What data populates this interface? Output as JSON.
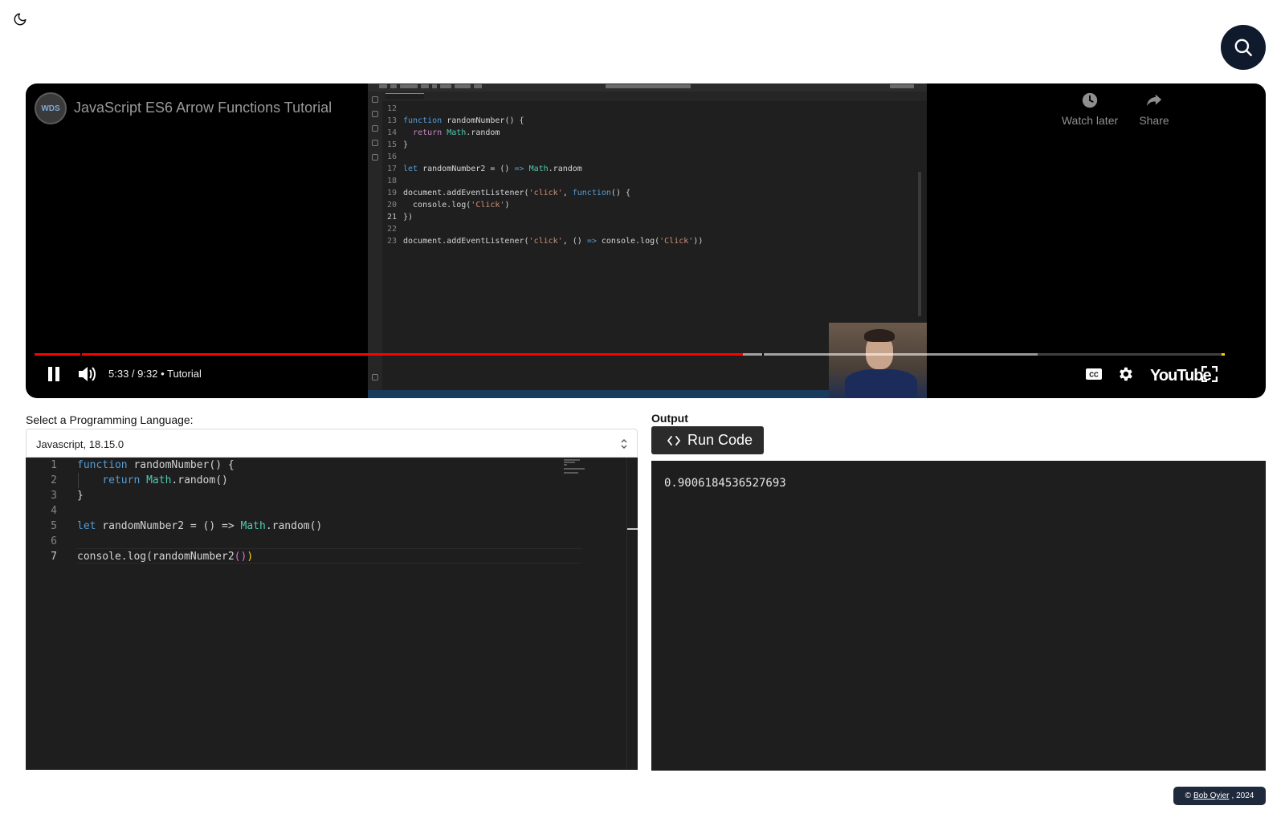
{
  "video": {
    "channel_logo": "WDS",
    "title": "JavaScript ES6 Arrow Functions Tutorial",
    "watch_later": "Watch later",
    "share": "Share",
    "time": "5:33 / 9:32",
    "chapter": "Tutorial",
    "youtube_logo": "YouTube",
    "progress_played": 0.595,
    "progress_buffered": 0.843,
    "code_lines": [
      {
        "n": "12",
        "code": ""
      },
      {
        "n": "13",
        "code": "function randomNumber() {"
      },
      {
        "n": "14",
        "code": "  return Math.random"
      },
      {
        "n": "15",
        "code": "}"
      },
      {
        "n": "16",
        "code": ""
      },
      {
        "n": "17",
        "code": "let randomNumber2 = () => Math.random"
      },
      {
        "n": "18",
        "code": ""
      },
      {
        "n": "19",
        "code": "document.addEventListener('click', function() {"
      },
      {
        "n": "20",
        "code": "  console.log('Click')"
      },
      {
        "n": "21",
        "code": "})"
      },
      {
        "n": "22",
        "code": ""
      },
      {
        "n": "23",
        "code": "document.addEventListener('click', () => console.log('Click'))"
      }
    ]
  },
  "editor": {
    "language_label": "Select a Programming Language:",
    "selected_language": "Javascript, 18.15.0",
    "lines": [
      {
        "n": "1",
        "code": "function randomNumber() {"
      },
      {
        "n": "2",
        "code": "    return Math.random()"
      },
      {
        "n": "3",
        "code": "}"
      },
      {
        "n": "4",
        "code": ""
      },
      {
        "n": "5",
        "code": "let randomNumber2 = () => Math.random()"
      },
      {
        "n": "6",
        "code": ""
      },
      {
        "n": "7",
        "code": "console.log(randomNumber2())"
      }
    ]
  },
  "output": {
    "label": "Output",
    "run_button": "Run Code",
    "result": "0.9006184536527693"
  },
  "footer": {
    "copyright_symbol": "©",
    "author": "Bob Oyier",
    "year": ", 2024"
  },
  "colors": {
    "search_button": "#0f1a2c",
    "progress_played": "#ff0000",
    "editor_bg": "#1e1e1e",
    "run_button": "#2b2b2b",
    "footer_badge": "#1e293b"
  },
  "icons": [
    "moon-icon",
    "search-icon",
    "clock-icon",
    "share-icon",
    "pause-icon",
    "volume-icon",
    "cc-icon",
    "settings-gear-icon",
    "fullscreen-icon",
    "code-brackets-icon",
    "select-chevron-icon"
  ]
}
